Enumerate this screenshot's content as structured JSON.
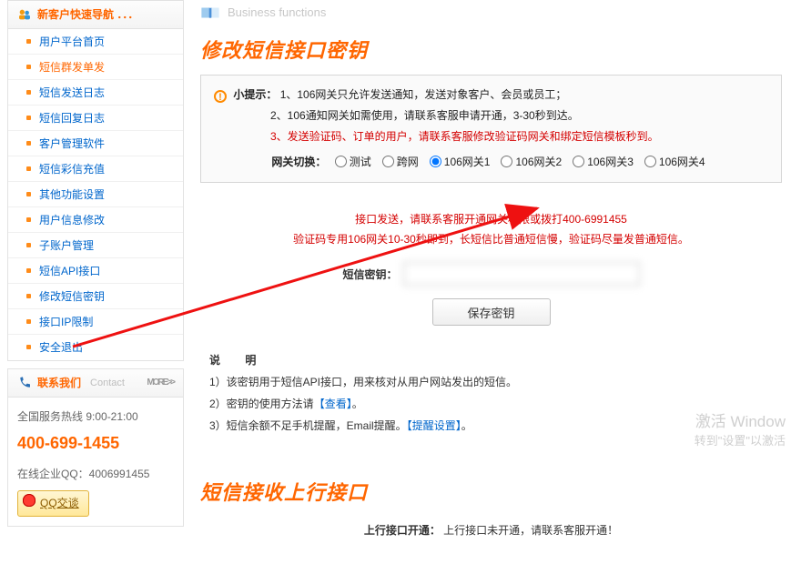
{
  "colors": {
    "accent": "#ff6600",
    "link": "#0066cc",
    "danger": "#d40000"
  },
  "sidebar": {
    "nav_title": "新客户快速导航 ．．．",
    "items": [
      {
        "label": "用户平台首页"
      },
      {
        "label": "短信群发单发",
        "active": true
      },
      {
        "label": "短信发送日志"
      },
      {
        "label": "短信回复日志"
      },
      {
        "label": "客户管理软件"
      },
      {
        "label": "短信彩信充值"
      },
      {
        "label": "其他功能设置"
      },
      {
        "label": "用户信息修改"
      },
      {
        "label": "子账户管理"
      },
      {
        "label": "短信API接口"
      },
      {
        "label": "修改短信密钥"
      },
      {
        "label": "接口IP限制"
      },
      {
        "label": "安全退出"
      }
    ],
    "contact": {
      "title": "联系我们",
      "title_en": "Contact",
      "more": "MORE>>",
      "hours": "全国服务热线 9:00-21:00",
      "hotline": "400-699-1455",
      "online_qq_label": "在线企业QQ：",
      "online_qq_value": "4006991455",
      "qq_btn": "QQ交谈"
    }
  },
  "main": {
    "biz_label": "Business functions",
    "section1_title": "修改短信接口密钥",
    "tip": {
      "label": "小提示：",
      "line1": "1、106网关只允许发送通知，发送对象客户、会员或员工；",
      "line2": "2、106通知网关如需使用，请联系客服申请开通，3-30秒到达。",
      "line3": "3、发送验证码、订单的用户，请联系客服修改验证码网关和绑定短信模板秒到。",
      "switch_label": "网关切换：",
      "options": [
        "测试",
        "跨网",
        "106网关1",
        "106网关2",
        "106网关3",
        "106网关4"
      ],
      "checked": "106网关1"
    },
    "red_note1": "接口发送，请联系客服开通网关权限或拨打400-6991455",
    "red_note2": "验证码专用106网关10-30秒即到，长短信比普通短信慢，验证码尽量发普通短信。",
    "key_label": "短信密钥：",
    "key_value": "",
    "save_btn": "保存密钥",
    "desc": {
      "heading": "说 明",
      "d1_pre": "1）该密钥用于短信API接口，用来核对从用户网站发出的短信。",
      "d2_pre": "2）密钥的使用方法请",
      "d2_link": "【查看】",
      "d2_post": "。",
      "d3_pre": "3）短信余额不足手机提醒，Email提醒。",
      "d3_link": "【提醒设置】",
      "d3_post": "。"
    },
    "section2_title": "短信接收上行接口",
    "upline": {
      "label": "上行接口开通：",
      "text": "上行接口未开通，请联系客服开通！"
    }
  },
  "watermark": {
    "big": "激活 Window",
    "small": "转到\"设置\"以激活"
  }
}
